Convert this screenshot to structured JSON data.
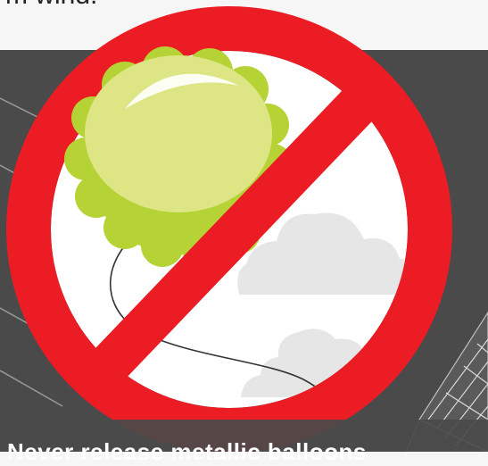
{
  "header": {
    "text": "m wind."
  },
  "caption": {
    "text": "Never release metallic balloons"
  },
  "sign": {
    "meaning": "prohibition",
    "ring_color": "#ec1c24",
    "inner_color": "#ffffff"
  },
  "balloon": {
    "color": "#b5d334",
    "highlight_color": "#dde585"
  },
  "background": {
    "color": "#4a4a4a"
  },
  "icons": [
    "prohibition-sign-icon",
    "balloon-icon",
    "cloud-icon",
    "power-tower-icon"
  ]
}
